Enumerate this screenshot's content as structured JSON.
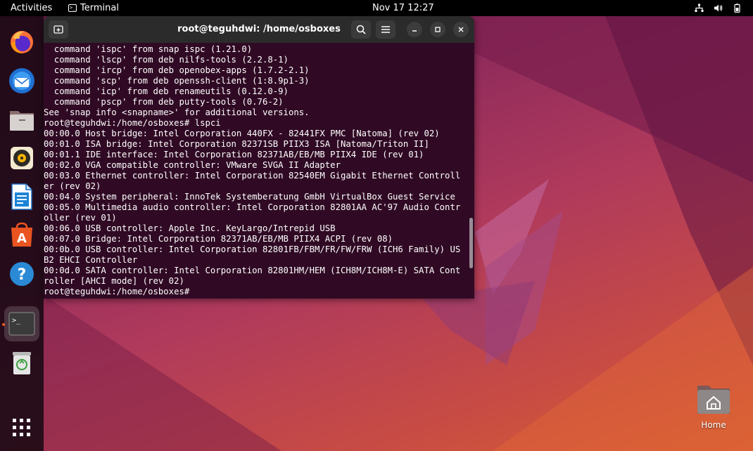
{
  "topbar": {
    "activities_label": "Activities",
    "app_name": "Terminal",
    "clock": "Nov 17  12:27"
  },
  "dock": {
    "items": [
      {
        "name": "Firefox",
        "icon": "firefox-icon"
      },
      {
        "name": "Thunderbird",
        "icon": "thunderbird-icon"
      },
      {
        "name": "Files",
        "icon": "files-icon"
      },
      {
        "name": "Rhythmbox",
        "icon": "rhythmbox-icon"
      },
      {
        "name": "LibreOffice Writer",
        "icon": "writer-icon"
      },
      {
        "name": "Ubuntu Software",
        "icon": "software-icon"
      },
      {
        "name": "Help",
        "icon": "help-icon"
      },
      {
        "name": "Terminal",
        "icon": "terminal-icon",
        "running": true
      },
      {
        "name": "Trash",
        "icon": "trash-icon"
      },
      {
        "name": "Show Applications",
        "icon": "app-grid-icon"
      }
    ]
  },
  "desktop": {
    "home_label": "Home"
  },
  "terminal": {
    "title": "root@teguhdwi: /home/osboxes",
    "lines": [
      "  command 'ispc' from snap ispc (1.21.0)",
      "  command 'lscp' from deb nilfs-tools (2.2.8-1)",
      "  command 'ircp' from deb openobex-apps (1.7.2-2.1)",
      "  command 'scp' from deb openssh-client (1:8.9p1-3)",
      "  command 'icp' from deb renameutils (0.12.0-9)",
      "  command 'pscp' from deb putty-tools (0.76-2)",
      "See 'snap info <snapname>' for additional versions.",
      "root@teguhdwi:/home/osboxes# lspci",
      "00:00.0 Host bridge: Intel Corporation 440FX - 82441FX PMC [Natoma] (rev 02)",
      "00:01.0 ISA bridge: Intel Corporation 82371SB PIIX3 ISA [Natoma/Triton II]",
      "00:01.1 IDE interface: Intel Corporation 82371AB/EB/MB PIIX4 IDE (rev 01)",
      "00:02.0 VGA compatible controller: VMware SVGA II Adapter",
      "00:03.0 Ethernet controller: Intel Corporation 82540EM Gigabit Ethernet Controll",
      "er (rev 02)",
      "00:04.0 System peripheral: InnoTek Systemberatung GmbH VirtualBox Guest Service",
      "00:05.0 Multimedia audio controller: Intel Corporation 82801AA AC'97 Audio Contr",
      "oller (rev 01)",
      "00:06.0 USB controller: Apple Inc. KeyLargo/Intrepid USB",
      "00:07.0 Bridge: Intel Corporation 82371AB/EB/MB PIIX4 ACPI (rev 08)",
      "00:0b.0 USB controller: Intel Corporation 82801FB/FBM/FR/FW/FRW (ICH6 Family) US",
      "B2 EHCI Controller",
      "00:0d.0 SATA controller: Intel Corporation 82801HM/HEM (ICH8M/ICH8M-E) SATA Cont",
      "roller [AHCI mode] (rev 02)",
      "root@teguhdwi:/home/osboxes# "
    ]
  }
}
